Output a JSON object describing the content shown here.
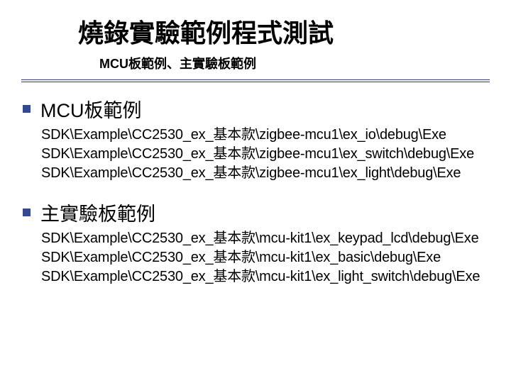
{
  "title": "燒錄實驗範例程式測試",
  "subtitle": "MCU板範例、主實驗板範例",
  "sections": [
    {
      "heading": "MCU板範例",
      "paths": [
        "SDK\\Example\\CC2530_ex_基本款\\zigbee-mcu1\\ex_io\\debug\\Exe",
        "SDK\\Example\\CC2530_ex_基本款\\zigbee-mcu1\\ex_switch\\debug\\Exe",
        "SDK\\Example\\CC2530_ex_基本款\\zigbee-mcu1\\ex_light\\debug\\Exe"
      ]
    },
    {
      "heading": "主實驗板範例",
      "paths": [
        "SDK\\Example\\CC2530_ex_基本款\\mcu-kit1\\ex_keypad_lcd\\debug\\Exe",
        "SDK\\Example\\CC2530_ex_基本款\\mcu-kit1\\ex_basic\\debug\\Exe",
        "SDK\\Example\\CC2530_ex_基本款\\mcu-kit1\\ex_light_switch\\debug\\Exe"
      ]
    }
  ]
}
